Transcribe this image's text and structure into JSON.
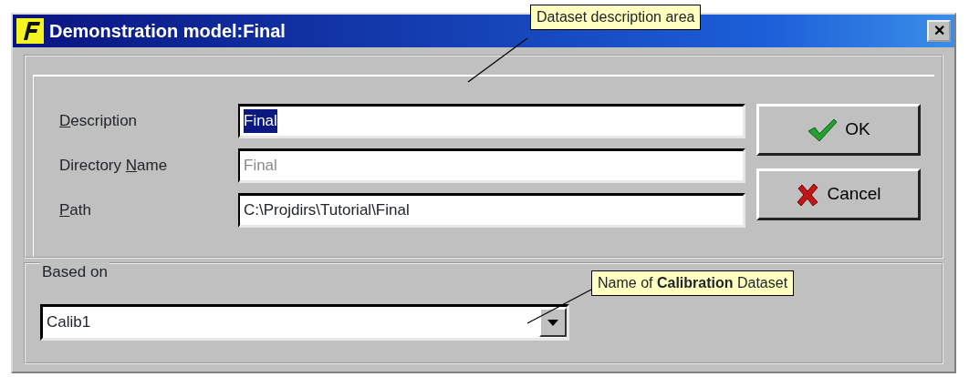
{
  "window": {
    "title": "Demonstration model:Final",
    "close": "✕"
  },
  "fields": [
    {
      "label": {
        "key": "D",
        "post": "escription"
      },
      "value": "Final",
      "selected": true,
      "disabled": false
    },
    {
      "label": {
        "pre": "Directory ",
        "key": "N",
        "post": "ame"
      },
      "value": "Final",
      "selected": false,
      "disabled": true
    },
    {
      "label": {
        "key": "P",
        "post": "ath"
      },
      "value": "C:\\Projdirs\\Tutorial\\Final",
      "selected": false,
      "disabled": false
    }
  ],
  "buttons": [
    {
      "label": "OK",
      "kind": "ok"
    },
    {
      "label": "Cancel",
      "kind": "cancel"
    }
  ],
  "based_on": {
    "title": "Based on",
    "value": "Calib1"
  },
  "callouts": [
    {
      "text": "Dataset description area"
    },
    {
      "text": "Name of **Calibration** Dataset"
    }
  ]
}
